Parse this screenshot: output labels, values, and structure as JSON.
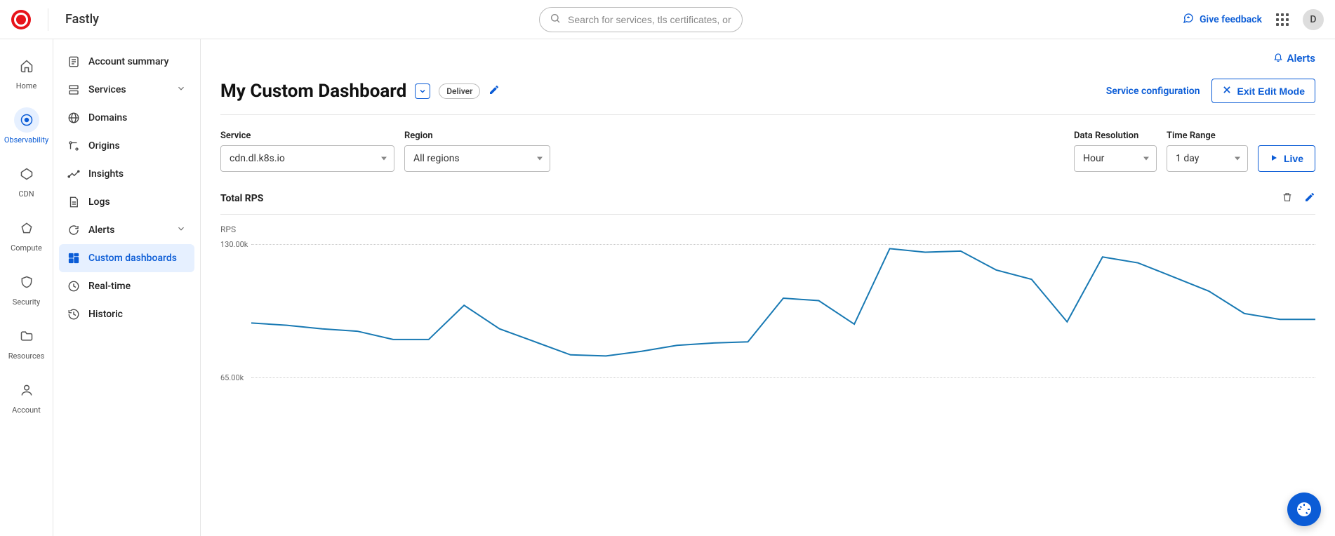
{
  "brand": "Fastly",
  "search": {
    "placeholder": "Search for services, tls certificates, or users"
  },
  "top": {
    "feedback": "Give feedback",
    "avatar_initial": "D"
  },
  "rail": {
    "items": [
      {
        "id": "home",
        "label": "Home"
      },
      {
        "id": "observability",
        "label": "Observability",
        "active": true
      },
      {
        "id": "cdn",
        "label": "CDN"
      },
      {
        "id": "compute",
        "label": "Compute"
      },
      {
        "id": "security",
        "label": "Security"
      },
      {
        "id": "resources",
        "label": "Resources"
      },
      {
        "id": "account",
        "label": "Account"
      }
    ]
  },
  "sidebar": {
    "items": [
      {
        "id": "account-summary",
        "label": "Account summary"
      },
      {
        "id": "services",
        "label": "Services",
        "expandable": true
      },
      {
        "id": "domains",
        "label": "Domains"
      },
      {
        "id": "origins",
        "label": "Origins"
      },
      {
        "id": "insights",
        "label": "Insights"
      },
      {
        "id": "logs",
        "label": "Logs"
      },
      {
        "id": "alerts",
        "label": "Alerts",
        "expandable": true
      },
      {
        "id": "custom-dashboards",
        "label": "Custom dashboards",
        "active": true
      },
      {
        "id": "real-time",
        "label": "Real-time"
      },
      {
        "id": "historic",
        "label": "Historic"
      }
    ]
  },
  "page": {
    "alerts_link": "Alerts",
    "title": "My Custom Dashboard",
    "tag": "Deliver",
    "service_config": "Service configuration",
    "exit_edit": "Exit Edit Mode"
  },
  "filters": {
    "service": {
      "label": "Service",
      "value": "cdn.dl.k8s.io"
    },
    "region": {
      "label": "Region",
      "value": "All regions"
    },
    "data_res": {
      "label": "Data Resolution",
      "value": "Hour"
    },
    "time": {
      "label": "Time Range",
      "value": "1 day"
    },
    "live": "Live"
  },
  "card": {
    "title": "Total RPS",
    "ylabel": "RPS"
  },
  "chart_data": {
    "type": "line",
    "title": "Total RPS",
    "ylabel": "RPS",
    "xlabel": "",
    "ylim": [
      65000,
      130000
    ],
    "y_ticks": [
      "130.00k",
      "65.00k"
    ],
    "series": [
      {
        "name": "RPS",
        "color": "#1879b3",
        "values": [
          96500,
          95500,
          94000,
          93000,
          89500,
          89500,
          104000,
          94000,
          88500,
          83000,
          82500,
          84500,
          87000,
          88000,
          88500,
          107000,
          106000,
          96000,
          128000,
          126500,
          127000,
          119000,
          115000,
          97000,
          124500,
          122000,
          116000,
          110000,
          100500,
          98000,
          98000
        ]
      }
    ]
  }
}
